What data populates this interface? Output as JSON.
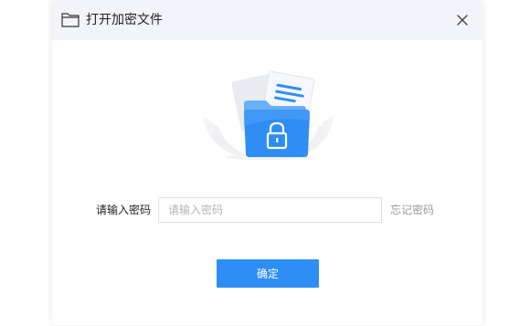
{
  "dialog": {
    "title": "打开加密文件",
    "title_icon": "folder-outline-icon",
    "close_icon": "close-icon"
  },
  "illustration": {
    "icon": "encrypted-folder-lock-icon",
    "accent_color": "#2f8ef5"
  },
  "form": {
    "password_label": "请输入密码",
    "password_placeholder": "请输入密码",
    "password_value": "",
    "forgot_password_link": "忘记密码"
  },
  "actions": {
    "confirm_label": "确定",
    "confirm_color": "#2f8ef5"
  }
}
